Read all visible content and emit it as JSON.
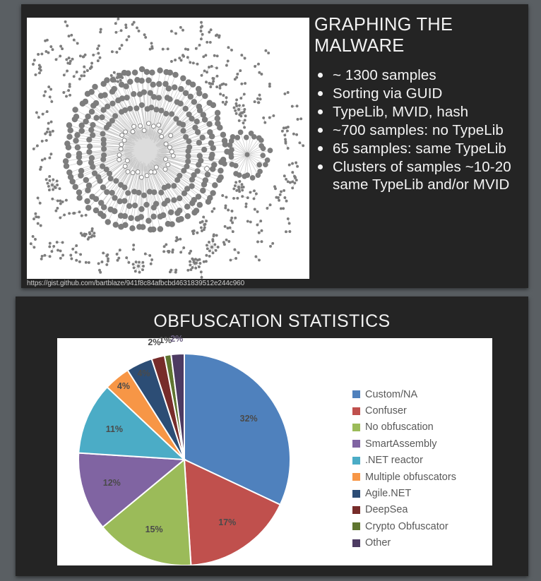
{
  "theme": {
    "deck_background": "#5a5f63",
    "slide_background": "#242424",
    "slide_text": "#f2f2f2",
    "panel_background": "#ffffff"
  },
  "slide_one": {
    "title": "GRAPHING THE MALWARE",
    "bullets": [
      "~ 1300 samples",
      "Sorting via GUID",
      "TypeLib, MVID, hash",
      "~700 samples: no TypeLib",
      "65 samples: same TypeLib",
      "Clusters of samples ~10-20 same TypeLib and/or MVID"
    ],
    "source_caption": "https://gist.github.com/bartblaze/941f8c84afbcbd4631839512e244c960",
    "graph_image": {
      "name": "malware-relationship-graph",
      "description": "Force-directed network graph of malware samples: one large dense hub cluster, one smaller satellite cluster, and many scattered isolated node pairs",
      "node_color": "#7d7d7d",
      "edge_color": "#c9c9c9",
      "background": "#ffffff"
    }
  },
  "slide_two": {
    "title": "OBFUSCATION STATISTICS"
  },
  "chart_data": {
    "type": "pie",
    "title": "OBFUSCATION STATISTICS",
    "xlabel": "",
    "ylabel": "",
    "legend_position": "right",
    "grid": false,
    "value_suffix": "%",
    "start_angle_deg": 0,
    "direction": "clockwise",
    "categories": [
      "Custom/NA",
      "Confuser",
      "No obfuscation",
      "SmartAssembly",
      ".NET reactor",
      "Multiple obfuscators",
      "Agile.NET",
      "DeepSea",
      "Crypto Obfuscator",
      "Other"
    ],
    "values": [
      32,
      17,
      15,
      12,
      11,
      4,
      4,
      2,
      1,
      2
    ],
    "data_labels": [
      "32%",
      "17%",
      "15%",
      "12%",
      "11%",
      "4%",
      "4%",
      "2%",
      "1%",
      "2%"
    ],
    "colors": [
      "#4f81bd",
      "#c0504d",
      "#9bbb59",
      "#8064a2",
      "#4bacc6",
      "#f79646",
      "#2c4d75",
      "#772c2a",
      "#5f7530",
      "#4d3b62"
    ]
  }
}
